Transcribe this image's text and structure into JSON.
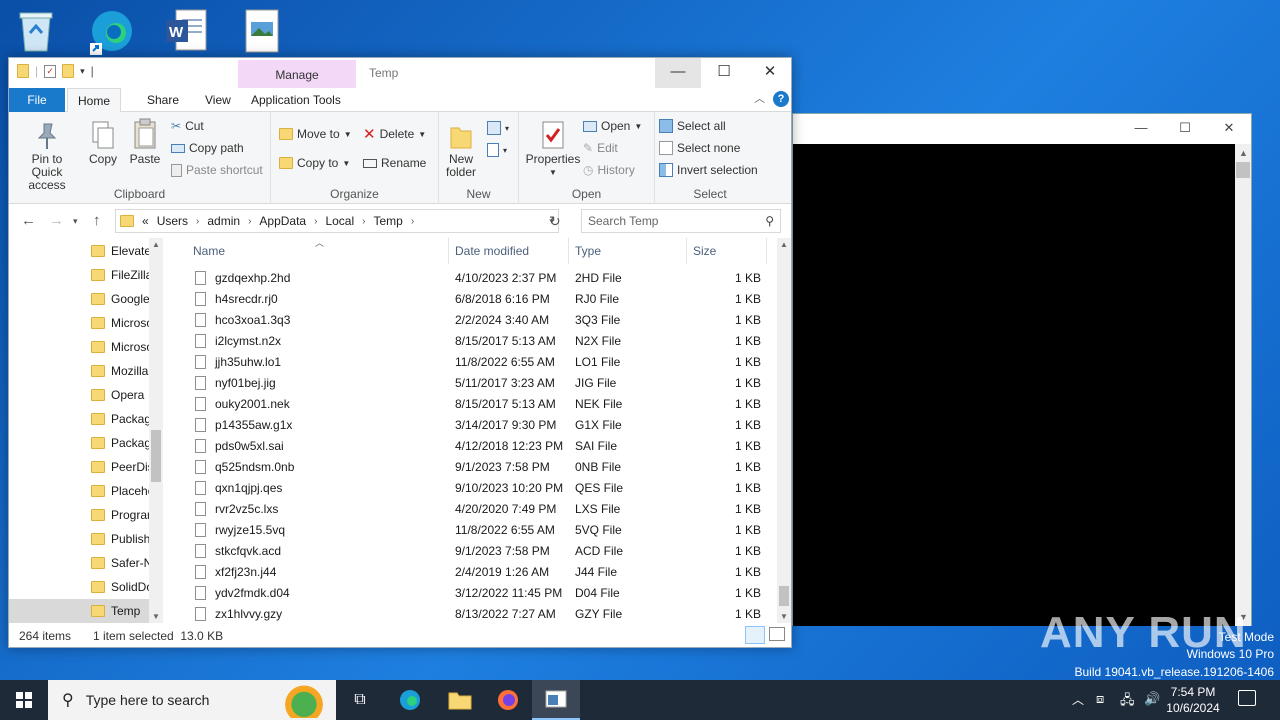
{
  "explorer": {
    "title": "Temp",
    "manage_tab": "Manage",
    "tabs": [
      "File",
      "Home",
      "Share",
      "View",
      "Application Tools"
    ],
    "ribbon": {
      "clipboard": {
        "pin": "Pin to Quick access",
        "copy": "Copy",
        "paste": "Paste",
        "cut": "Cut",
        "copy_path": "Copy path",
        "paste_shortcut": "Paste shortcut",
        "label": "Clipboard"
      },
      "organize": {
        "move_to": "Move to",
        "copy_to": "Copy to",
        "delete": "Delete",
        "rename": "Rename",
        "label": "Organize"
      },
      "new": {
        "new_folder": "New folder",
        "label": "New"
      },
      "open": {
        "properties": "Properties",
        "open": "Open",
        "edit": "Edit",
        "history": "History",
        "label": "Open"
      },
      "select": {
        "select_all": "Select all",
        "select_none": "Select none",
        "invert": "Invert selection",
        "label": "Select"
      }
    },
    "address": {
      "prefix": "«",
      "crumbs": [
        "Users",
        "admin",
        "AppData",
        "Local",
        "Temp"
      ]
    },
    "search_placeholder": "Search Temp",
    "nav_items": [
      "Elevate",
      "FileZilla",
      "Google",
      "Microso",
      "Microso",
      "Mozilla",
      "Opera",
      "Packag",
      "Packag",
      "PeerDis",
      "Placeho",
      "Progran",
      "Publish",
      "Safer-N",
      "SolidDo",
      "Temp"
    ],
    "columns": {
      "name": "Name",
      "date": "Date modified",
      "type": "Type",
      "size": "Size"
    },
    "files": [
      {
        "name": "gzdqexhp.2hd",
        "date": "4/10/2023 2:37 PM",
        "type": "2HD File",
        "size": "1 KB"
      },
      {
        "name": "h4srecdr.rj0",
        "date": "6/8/2018 6:16 PM",
        "type": "RJ0 File",
        "size": "1 KB"
      },
      {
        "name": "hco3xoa1.3q3",
        "date": "2/2/2024 3:40 AM",
        "type": "3Q3 File",
        "size": "1 KB"
      },
      {
        "name": "i2lcymst.n2x",
        "date": "8/15/2017 5:13 AM",
        "type": "N2X File",
        "size": "1 KB"
      },
      {
        "name": "jjh35uhw.lo1",
        "date": "11/8/2022 6:55 AM",
        "type": "LO1 File",
        "size": "1 KB"
      },
      {
        "name": "nyf01bej.jig",
        "date": "5/11/2017 3:23 AM",
        "type": "JIG File",
        "size": "1 KB"
      },
      {
        "name": "ouky2001.nek",
        "date": "8/15/2017 5:13 AM",
        "type": "NEK File",
        "size": "1 KB"
      },
      {
        "name": "p14355aw.g1x",
        "date": "3/14/2017 9:30 PM",
        "type": "G1X File",
        "size": "1 KB"
      },
      {
        "name": "pds0w5xl.sai",
        "date": "4/12/2018 12:23 PM",
        "type": "SAI File",
        "size": "1 KB"
      },
      {
        "name": "q525ndsm.0nb",
        "date": "9/1/2023 7:58 PM",
        "type": "0NB File",
        "size": "1 KB"
      },
      {
        "name": "qxn1qjpj.qes",
        "date": "9/10/2023 10:20 PM",
        "type": "QES File",
        "size": "1 KB"
      },
      {
        "name": "rvr2vz5c.lxs",
        "date": "4/20/2020 7:49 PM",
        "type": "LXS File",
        "size": "1 KB"
      },
      {
        "name": "rwyjze15.5vq",
        "date": "11/8/2022 6:55 AM",
        "type": "5VQ File",
        "size": "1 KB"
      },
      {
        "name": "stkcfqvk.acd",
        "date": "9/1/2023 7:58 PM",
        "type": "ACD File",
        "size": "1 KB"
      },
      {
        "name": "xf2fj23n.j44",
        "date": "2/4/2019 1:26 AM",
        "type": "J44 File",
        "size": "1 KB"
      },
      {
        "name": "ydv2fmdk.d04",
        "date": "3/12/2022 11:45 PM",
        "type": "D04 File",
        "size": "1 KB"
      },
      {
        "name": "zx1hlvvy.gzy",
        "date": "8/13/2022 7:27 AM",
        "type": "GZY File",
        "size": "1 KB"
      }
    ],
    "status": {
      "count": "264 items",
      "selected": "1 item selected  13.0 KB"
    }
  },
  "taskbar": {
    "search_placeholder": "Type here to search",
    "time": "7:54 PM",
    "date": "10/6/2024"
  },
  "watermark": {
    "brand": "ANY RUN",
    "line1": "Test Mode",
    "line2": "Windows 10 Pro",
    "line3": "Build 19041.vb_release.191206-1406"
  },
  "colors": {
    "accent": "#1979ca",
    "taskbar": "#1f2a38",
    "manage_tab": "#f3d9f7"
  }
}
